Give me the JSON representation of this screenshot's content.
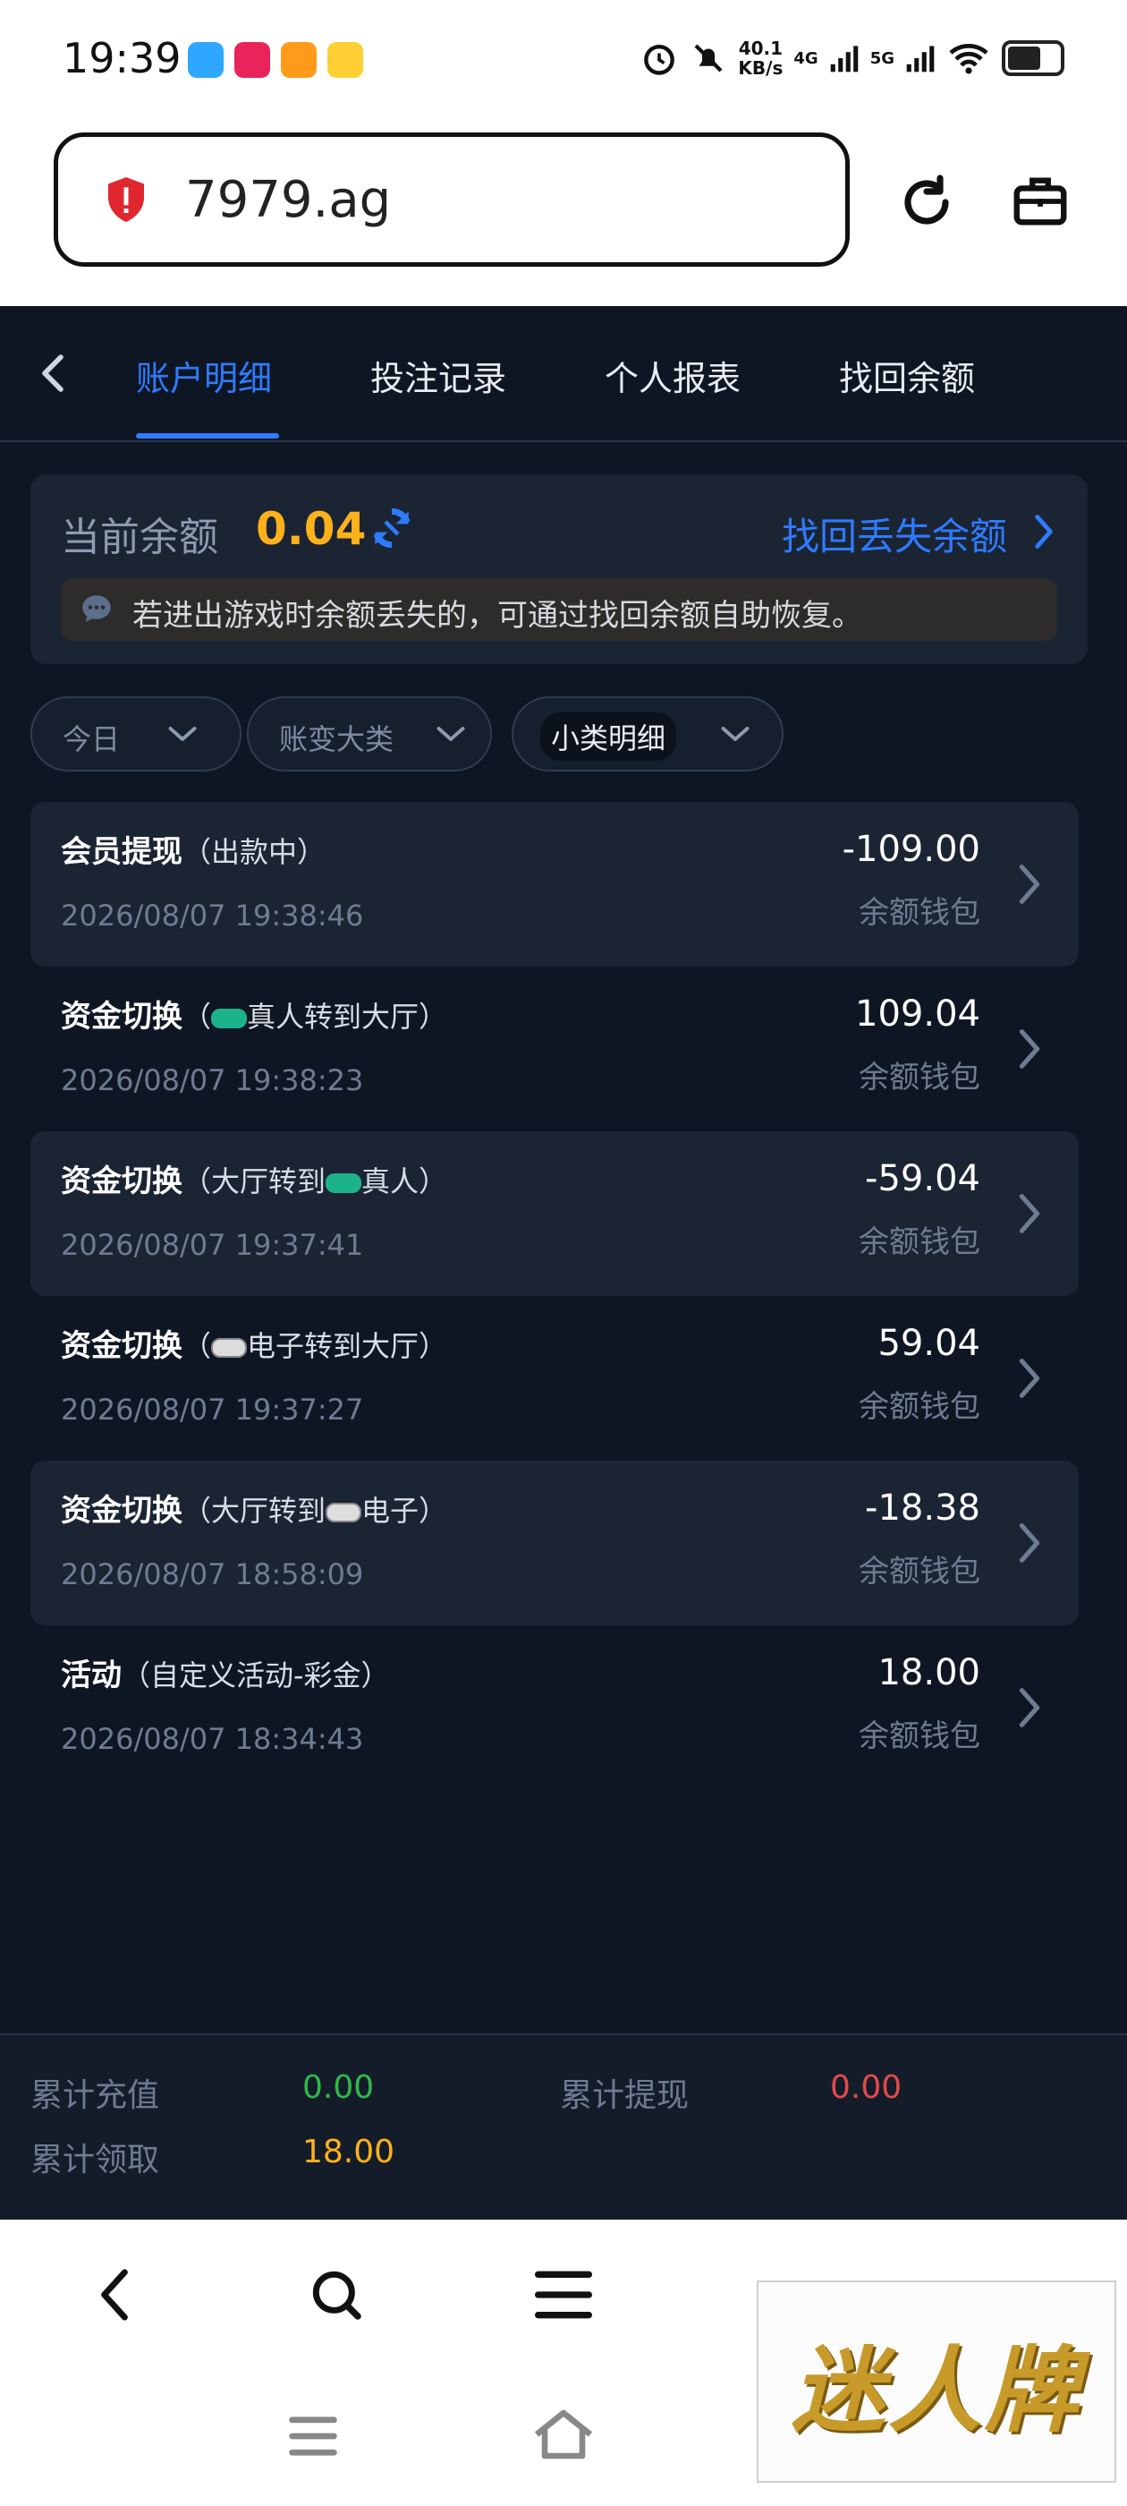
{
  "status_bar": {
    "time": "19:39",
    "speed": "40.1",
    "speed_unit": "KB/s",
    "net1": "4G",
    "net2": "5G",
    "app_icons": [
      "browser-icon",
      "games-icon",
      "video-icon",
      "weibo-icon"
    ]
  },
  "browser": {
    "url": "7979.ag",
    "security_color": "#e0262f"
  },
  "tabs": {
    "items": [
      {
        "label": "账户明细",
        "active": true
      },
      {
        "label": "投注记录",
        "active": false
      },
      {
        "label": "个人报表",
        "active": false
      },
      {
        "label": "找回余额",
        "active": false
      }
    ]
  },
  "balance": {
    "label": "当前余额",
    "value": "0.04",
    "recover_label": "找回丢失余额",
    "notice": "若进出游戏时余额丢失的，可通过找回余额自助恢复。"
  },
  "filters": [
    {
      "label": "今日",
      "selected": false
    },
    {
      "label": "账变大类",
      "selected": false
    },
    {
      "label": "小类明细",
      "selected": true
    }
  ],
  "transactions": [
    {
      "title": "会员提现",
      "sub_pre": "（出款中）",
      "logo": "",
      "sub_post": "",
      "time": "2026/08/07 19:38:46",
      "amount": "-109.00",
      "wallet": "余额钱包"
    },
    {
      "title": "资金切换",
      "sub_pre": "（",
      "logo": "live",
      "sub_post": "真人转到大厅）",
      "time": "2026/08/07 19:38:23",
      "amount": "109.04",
      "wallet": "余额钱包"
    },
    {
      "title": "资金切换",
      "sub_pre": "（大厅转到",
      "logo": "live",
      "sub_post": "真人）",
      "time": "2026/08/07 19:37:41",
      "amount": "-59.04",
      "wallet": "余额钱包"
    },
    {
      "title": "资金切换",
      "sub_pre": "（",
      "logo": "pg",
      "sub_post": "电子转到大厅）",
      "time": "2026/08/07 19:37:27",
      "amount": "59.04",
      "wallet": "余额钱包"
    },
    {
      "title": "资金切换",
      "sub_pre": "（大厅转到",
      "logo": "pg",
      "sub_post": "电子）",
      "time": "2026/08/07 18:58:09",
      "amount": "-18.38",
      "wallet": "余额钱包"
    },
    {
      "title": "活动",
      "sub_pre": "（自定义活动-彩金）",
      "logo": "",
      "sub_post": "",
      "time": "2026/08/07 18:34:43",
      "amount": "18.00",
      "wallet": "余额钱包"
    }
  ],
  "totals": {
    "deposit_label": "累计充值",
    "deposit_value": "0.00",
    "deposit_color": "#2fb84a",
    "withdraw_label": "累计提现",
    "withdraw_value": "0.00",
    "withdraw_color": "#e24a4a",
    "claim_label": "累计领取",
    "claim_value": "18.00",
    "claim_color": "#ffb11b"
  },
  "watermark": {
    "text": "迷人牌"
  }
}
